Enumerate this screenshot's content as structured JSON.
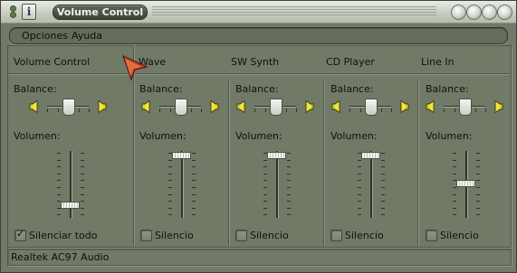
{
  "window": {
    "title": "Volume Control"
  },
  "menu": [
    {
      "label": "Opciones"
    },
    {
      "label": "Ayuda"
    }
  ],
  "labels": {
    "balance": "Balance:",
    "volume": "Volumen:"
  },
  "channels": [
    {
      "name": "Volume Control",
      "mute_label": "Silenciar todo",
      "muted": true,
      "volume_level": 0.15,
      "balance": 0.5
    },
    {
      "name": "Wave",
      "mute_label": "Silencio",
      "muted": false,
      "volume_level": 0.95,
      "balance": 0.5
    },
    {
      "name": "SW Synth",
      "mute_label": "Silencio",
      "muted": false,
      "volume_level": 0.95,
      "balance": 0.5
    },
    {
      "name": "CD Player",
      "mute_label": "Silencio",
      "muted": false,
      "volume_level": 0.95,
      "balance": 0.5
    },
    {
      "name": "Line In",
      "mute_label": "Silencio",
      "muted": false,
      "volume_level": 0.5,
      "balance": 0.5
    }
  ],
  "status": {
    "text": "Realtek AC97 Audio"
  },
  "colors": {
    "window_bg": "#707a67",
    "titlebar": "#c8cdc2",
    "accent_cursor": "#c8452a"
  },
  "icons": {
    "speaker": "speaker-icon",
    "info": "info-icon"
  }
}
